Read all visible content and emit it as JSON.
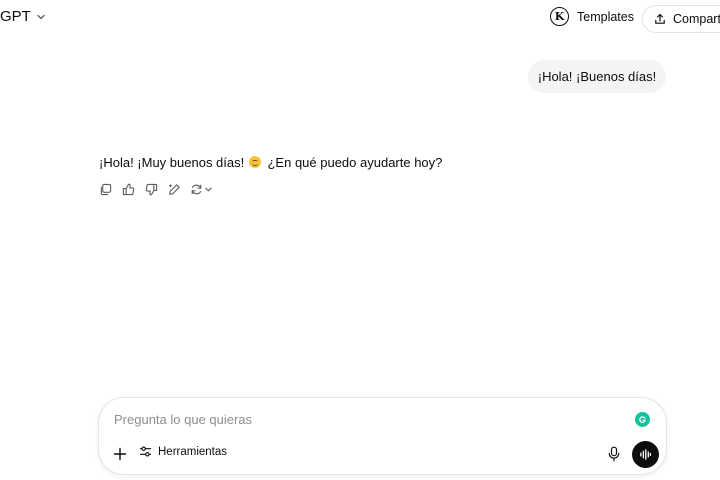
{
  "header": {
    "model_name": "GPT",
    "templates_logo_letter": "K",
    "templates_label": "Templates",
    "share_label": "Compartir"
  },
  "conversation": {
    "user_message": "¡Hola! ¡Buenos días!",
    "assistant_message_before_emoji": "¡Hola! ¡Muy buenos días!",
    "assistant_emoji": "smiling-face-emoji",
    "assistant_message_after_emoji": "¿En qué puedo ayudarte hoy?",
    "message_actions": [
      "copy-icon",
      "thumbs-up-icon",
      "thumbs-down-icon",
      "edit-icon",
      "regenerate-icon"
    ]
  },
  "composer": {
    "placeholder": "Pregunta lo que quieras",
    "value": "",
    "tools_label": "Herramientas"
  },
  "colors": {
    "user_bubble_bg": "#f4f4f4",
    "grammarly_green": "#15c39a",
    "voice_button_bg": "#0d0d0d",
    "placeholder_text": "#8f8f8f"
  }
}
